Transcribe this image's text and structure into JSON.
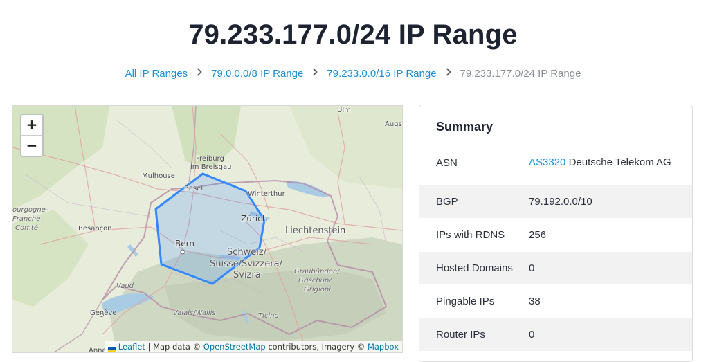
{
  "page": {
    "title": "79.233.177.0/24 IP Range"
  },
  "breadcrumb": {
    "items": [
      {
        "label": "All IP Ranges"
      },
      {
        "label": "79.0.0.0/8 IP Range"
      },
      {
        "label": "79.233.0.0/16 IP Range"
      }
    ],
    "current": "79.233.177.0/24 IP Range"
  },
  "map": {
    "zoom_in": "+",
    "zoom_out": "−",
    "labels": {
      "ulm": "Ulm",
      "augsburg": "Augsl",
      "freiburg_1": "Freiburg",
      "freiburg_2": "im Breisgau",
      "mulhouse": "Mulhouse",
      "basel": "Basel",
      "winterthur": "Winterthur",
      "zurich": "Zürich",
      "liechtenstein": "Liechtenstein",
      "bourgogne_1": "ourgogne-",
      "bourgogne_2": "Franche-",
      "bourgogne_3": "Comté",
      "besancon": "Besançon",
      "bern": "Bern",
      "schweiz_1": "Schweiz/",
      "schweiz_2": "Suisse/Svizzera/",
      "schweiz_3": "Svizra",
      "graubunden_1": "Graubünden/",
      "graubunden_2": "Grischun/",
      "graubunden_3": "Grigioni",
      "vaud": "Vaud",
      "geneve": "Genève",
      "valais": "Valais/Wallis",
      "ticino": "Ticino",
      "annecy": "Annecy"
    },
    "attribution": {
      "leaflet": "Leaflet",
      "map_data": "| Map data ©",
      "osm": "OpenStreetMap",
      "contributors": "contributors, Imagery ©",
      "mapbox": "Mapbox"
    },
    "polygon_color": "#3388ff"
  },
  "summary": {
    "title": "Summary",
    "rows": [
      {
        "key": "ASN",
        "link": "AS3320",
        "value": "Deutsche Telekom AG"
      },
      {
        "key": "BGP",
        "value": "79.192.0.0/10"
      },
      {
        "key": "IPs with RDNS",
        "value": "256"
      },
      {
        "key": "Hosted Domains",
        "value": "0"
      },
      {
        "key": "Pingable IPs",
        "value": "38"
      },
      {
        "key": "Router IPs",
        "value": "0"
      }
    ]
  }
}
